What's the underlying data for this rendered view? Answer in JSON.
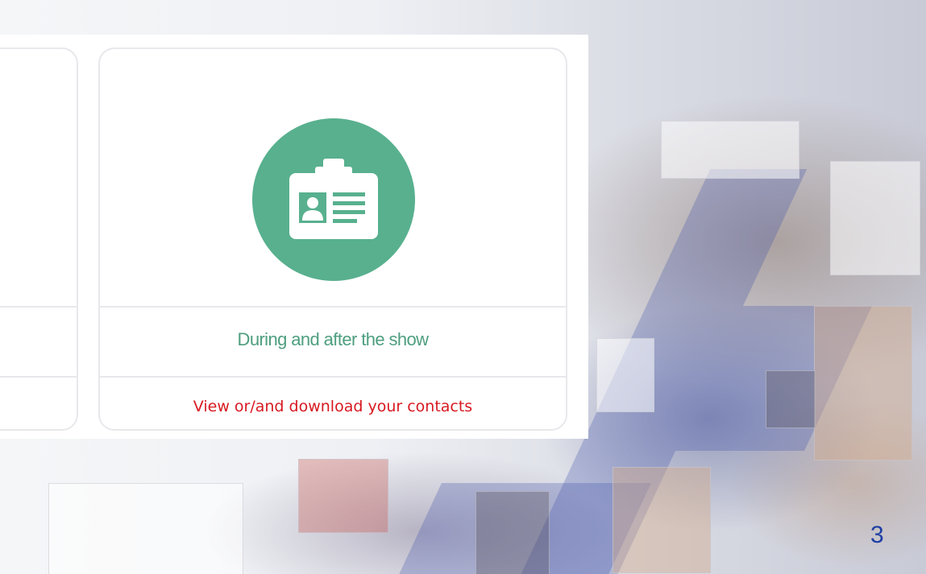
{
  "card": {
    "title": "During and after the show",
    "link_label": "View or/and download your contacts",
    "icon": "badge-icon"
  },
  "page": {
    "number": "3"
  },
  "colors": {
    "icon_circle": "#58b08e",
    "title": "#4d9e7f",
    "link": "#d71920",
    "page_number": "#1f3fa4"
  }
}
